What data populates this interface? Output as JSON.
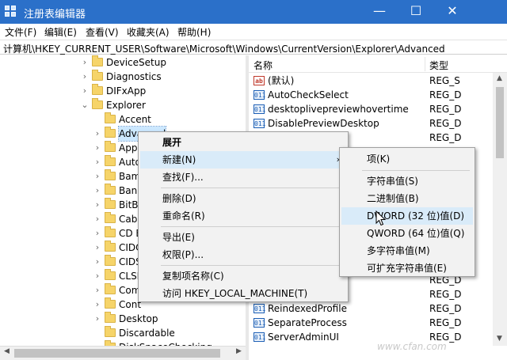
{
  "window": {
    "title": "注册表编辑器",
    "minimize_glyph": "—",
    "maximize_glyph": "☐",
    "close_glyph": "✕",
    "title_color": "#2b70c9"
  },
  "menubar": [
    "文件(F)",
    "编辑(E)",
    "查看(V)",
    "收藏夹(A)",
    "帮助(H)"
  ],
  "address": "计算机\\HKEY_CURRENT_USER\\Software\\Microsoft\\Windows\\CurrentVersion\\Explorer\\Advanced",
  "tree": [
    {
      "label": "DeviceSetup",
      "expanded": false
    },
    {
      "label": "Diagnostics",
      "expanded": false
    },
    {
      "label": "DIFxApp",
      "expanded": false
    },
    {
      "label": "Explorer",
      "expanded": true
    },
    {
      "label": "Accent",
      "expanded": false
    },
    {
      "label": "Advanced",
      "expanded": false,
      "selected": true
    },
    {
      "label": "AppC",
      "expanded": false
    },
    {
      "label": "Auto",
      "expanded": false
    },
    {
      "label": "Bam",
      "expanded": false
    },
    {
      "label": "Bann",
      "expanded": false
    },
    {
      "label": "BitBu",
      "expanded": false
    },
    {
      "label": "Cabl",
      "expanded": false
    },
    {
      "label": "CD E",
      "expanded": false
    },
    {
      "label": "CIDO",
      "expanded": false
    },
    {
      "label": "CIDS",
      "expanded": false
    },
    {
      "label": "CLSI",
      "expanded": false
    },
    {
      "label": "Com",
      "expanded": false
    },
    {
      "label": "Cont",
      "expanded": false
    },
    {
      "label": "Desktop",
      "expanded": false
    },
    {
      "label": "Discardable",
      "expanded": false
    },
    {
      "label": "DiskSpaceChecking",
      "expanded": false
    }
  ],
  "list": {
    "col_name": "名称",
    "col_type": "类型",
    "rows": [
      {
        "icon": "string-value-icon",
        "name": "(默认)",
        "type": "REG_S"
      },
      {
        "icon": "binary-value-icon",
        "name": "AutoCheckSelect",
        "type": "REG_D"
      },
      {
        "icon": "binary-value-icon",
        "name": "desktoplivepreviewhovertime",
        "type": "REG_D"
      },
      {
        "icon": "binary-value-icon",
        "name": "DisablePreviewDesktop",
        "type": "REG_D"
      },
      {
        "icon": "binary-value-icon",
        "name": "",
        "type": "REG_D"
      },
      {
        "icon": "binary-value-icon",
        "name": "",
        "type": "REG_D"
      },
      {
        "icon": "binary-value-icon",
        "name": "",
        "type": "REG_D"
      },
      {
        "icon": "binary-value-icon",
        "name": "",
        "type": "REG_D"
      },
      {
        "icon": "binary-value-icon",
        "name": "",
        "type": "REG_D"
      },
      {
        "icon": "binary-value-icon",
        "name": "",
        "type": "REG_D"
      },
      {
        "icon": "binary-value-icon",
        "name": "",
        "type": "REG_D"
      },
      {
        "icon": "binary-value-icon",
        "name": "",
        "type": "REG_D"
      },
      {
        "icon": "binary-value-icon",
        "name": "",
        "type": "REG_D"
      },
      {
        "icon": "binary-value-icon",
        "name": "",
        "type": "REG_D"
      },
      {
        "icon": "binary-value-icon",
        "name": "",
        "type": "REG_D"
      },
      {
        "icon": "binary-value-icon",
        "name": "",
        "type": "REG_D"
      },
      {
        "icon": "binary-value-icon",
        "name": "ReindexedProfile",
        "type": "REG_D"
      },
      {
        "icon": "binary-value-icon",
        "name": "SeparateProcess",
        "type": "REG_D"
      },
      {
        "icon": "binary-value-icon",
        "name": "ServerAdminUI",
        "type": "REG_D"
      }
    ]
  },
  "context_menu": {
    "items": [
      "展开",
      "新建(N)",
      "查找(F)...",
      "删除(D)",
      "重命名(R)",
      "导出(E)",
      "权限(P)...",
      "复制项名称(C)",
      "访问 HKEY_LOCAL_MACHINE(T)"
    ],
    "submenu_arrow": "›"
  },
  "submenu": {
    "items": [
      "项(K)",
      "字符串值(S)",
      "二进制值(B)",
      "DWORD (32 位)值(D)",
      "QWORD (64 位)值(Q)",
      "多字符串值(M)",
      "可扩充字符串值(E)"
    ]
  },
  "colors": {
    "hover": "#d9ebf9",
    "selection": "#cce8ff",
    "folder": "#f6d469"
  },
  "watermark": "www.cfan.com"
}
